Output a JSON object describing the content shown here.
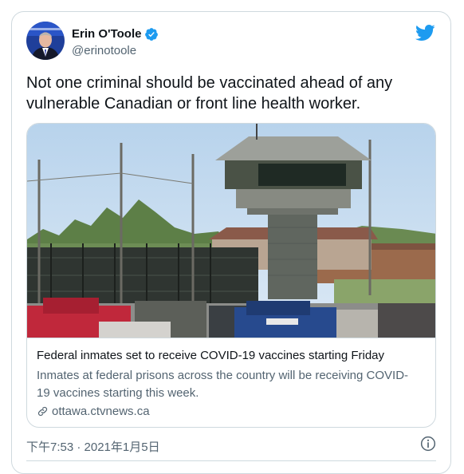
{
  "author": {
    "name": "Erin O'Toole",
    "handle": "@erinotoole"
  },
  "tweet": {
    "text": "Not one criminal should be vaccinated ahead of any vulnerable Canadian or front line health worker."
  },
  "card": {
    "title": "Federal inmates set to receive COVID-19 vaccines starting Friday",
    "description": "Inmates at federal prisons across the country will be receiving COVID-19 vaccines starting this week.",
    "domain": "ottawa.ctvnews.ca"
  },
  "meta": {
    "timestamp": "下午7:53 · 2021年1月5日"
  },
  "icons": {
    "verified": "verified-badge-icon",
    "logo": "twitter-bird-icon",
    "link": "link-icon",
    "info": "info-icon"
  },
  "colors": {
    "brand": "#1d9bf0",
    "text": "#0f1419",
    "secondary": "#536471",
    "border": "#cfd9de"
  }
}
